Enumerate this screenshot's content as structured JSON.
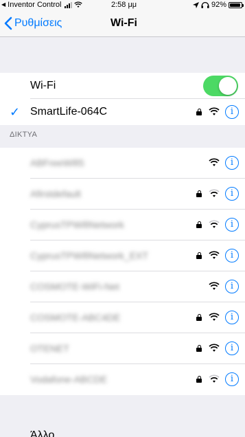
{
  "status_bar": {
    "carrier": "Inventor Control",
    "time": "2:58 μμ",
    "battery": "92%",
    "battery_level": 0.92
  },
  "nav": {
    "back_label": "Ρυθμίσεις",
    "title": "Wi-Fi"
  },
  "wifi": {
    "label": "Wi-Fi",
    "enabled": true,
    "connected_network": "SmartLife-064C"
  },
  "section": {
    "networks_header": "ΔΙΚΤΥΑ"
  },
  "networks": [
    {
      "name": "ABFreeWifi5",
      "secured": false,
      "signal": 3
    },
    {
      "name": "Afirstdefault",
      "secured": true,
      "signal": 2
    },
    {
      "name": "CyprusTPWifiNetwork",
      "secured": true,
      "signal": 2
    },
    {
      "name": "CyprusTPWifiNetwork_EXT",
      "secured": true,
      "signal": 3
    },
    {
      "name": "COSMOTE-WiFi-Net",
      "secured": false,
      "signal": 3
    },
    {
      "name": "COSMOTE-ABC4DE",
      "secured": true,
      "signal": 3
    },
    {
      "name": "OTENET",
      "secured": true,
      "signal": 3
    },
    {
      "name": "Vodafone-ABCDE",
      "secured": true,
      "signal": 2
    }
  ],
  "other": {
    "label": "Άλλο..."
  },
  "colors": {
    "accent": "#007aff",
    "toggle_on": "#4cd964",
    "background": "#efeff4"
  }
}
